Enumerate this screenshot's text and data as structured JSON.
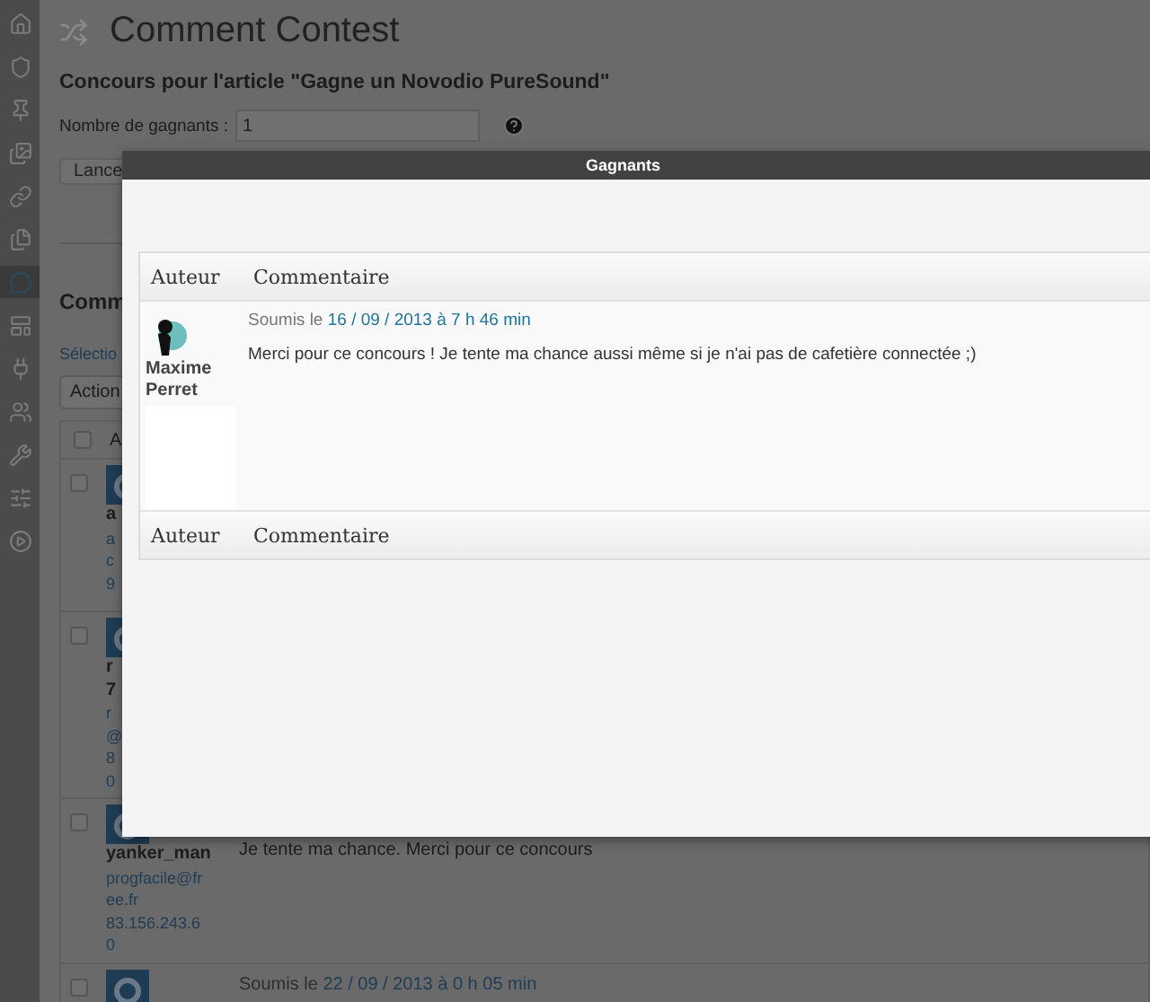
{
  "sidebar": {
    "items": [
      {
        "kind": "home",
        "selected": false
      },
      {
        "kind": "shield",
        "selected": false
      },
      {
        "kind": "pin",
        "selected": false
      },
      {
        "kind": "media",
        "selected": false
      },
      {
        "kind": "link",
        "selected": false
      },
      {
        "kind": "pages",
        "selected": false
      },
      {
        "kind": "comments",
        "selected": true
      },
      {
        "kind": "layout",
        "selected": false
      },
      {
        "kind": "plugins",
        "selected": false
      },
      {
        "kind": "users",
        "selected": false
      },
      {
        "kind": "tools",
        "selected": false
      },
      {
        "kind": "settings",
        "selected": false
      },
      {
        "kind": "collapse",
        "selected": false
      }
    ]
  },
  "page": {
    "title": "Comment Contest",
    "heading": "Concours pour l'article \"Gagne un Novodio PureSound\"",
    "winners_field": {
      "label": "Nombre de gagnants :",
      "value": "1"
    },
    "launch_button": "Lance",
    "section_heading": "Comm",
    "select_link": "Sélectio",
    "bulk_actions": "Action",
    "table_header": "A",
    "select_all_checked": false,
    "rows": [
      {
        "checked": false,
        "lines": [
          {
            "text": "a",
            "bold": true
          },
          {
            "text": "a",
            "bold": false
          },
          {
            "text": "c",
            "bold": false
          },
          {
            "text": "9",
            "bold": false
          }
        ]
      },
      {
        "checked": false,
        "lines": [
          {
            "text": "r",
            "bold": true
          },
          {
            "text": "7",
            "bold": true
          },
          {
            "text": "r",
            "bold": false
          },
          {
            "text": "@",
            "bold": false
          },
          {
            "text": "8",
            "bold": false
          },
          {
            "text": "0",
            "bold": false
          }
        ]
      },
      {
        "checked": false,
        "lines": [
          {
            "text": "yanker_man",
            "bold": true
          },
          {
            "text": "progfacile@fr",
            "bold": false
          },
          {
            "text": "ee.fr",
            "bold": false
          },
          {
            "text": "83.156.243.6",
            "bold": false
          },
          {
            "text": "0",
            "bold": false
          }
        ],
        "comment": "Je tente ma chance. Merci pour ce concours"
      },
      {
        "checked": false,
        "lines": [],
        "submitted": "Soumis le",
        "date": "22 / 09 / 2013 à 0 h 05 min"
      }
    ]
  },
  "dialog": {
    "title": "Gagnants",
    "columns": [
      "Auteur",
      "Commentaire"
    ],
    "winners": [
      {
        "author": "Maxime Perret",
        "submitted": "Soumis le",
        "date": "16 / 09 / 2013 à 7 h 46 min",
        "comment": "Merci pour ce concours ! Je tente ma chance aussi même si je n'ai pas de cafetière connectée ;)"
      }
    ],
    "footer_columns": [
      "Auteur",
      "Commentaire"
    ]
  }
}
